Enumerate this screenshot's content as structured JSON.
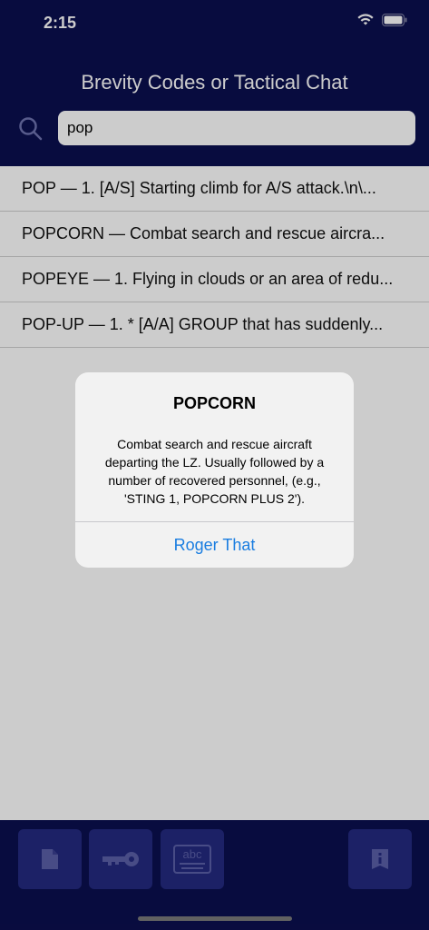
{
  "status_bar": {
    "time": "2:15"
  },
  "header": {
    "title": "Brevity Codes or Tactical Chat"
  },
  "search": {
    "value": "pop"
  },
  "results": [
    {
      "text": "POP — 1. [A/S] Starting climb for A/S attack.\\n\\..."
    },
    {
      "text": "POPCORN — Combat search and rescue aircra..."
    },
    {
      "text": "POPEYE — 1. Flying in clouds or an area of redu..."
    },
    {
      "text": "POP-UP — 1. * [A/A] GROUP that has suddenly..."
    }
  ],
  "alert": {
    "title": "POPCORN",
    "message": "Combat search and rescue aircraft departing the LZ. Usually followed by a number of recovered personnel, (e.g., 'STING 1, POPCORN PLUS 2').",
    "button_label": "Roger That"
  },
  "tabbar": {
    "tabs": [
      {
        "icon": "document-icon"
      },
      {
        "icon": "key-icon"
      },
      {
        "icon": "keyboard-icon",
        "label": "abc"
      },
      {
        "icon": "info-icon"
      }
    ]
  },
  "colors": {
    "header_bg": "#0b0f4f",
    "accent": "#1a7de0",
    "tab_bg": "#242a80"
  }
}
